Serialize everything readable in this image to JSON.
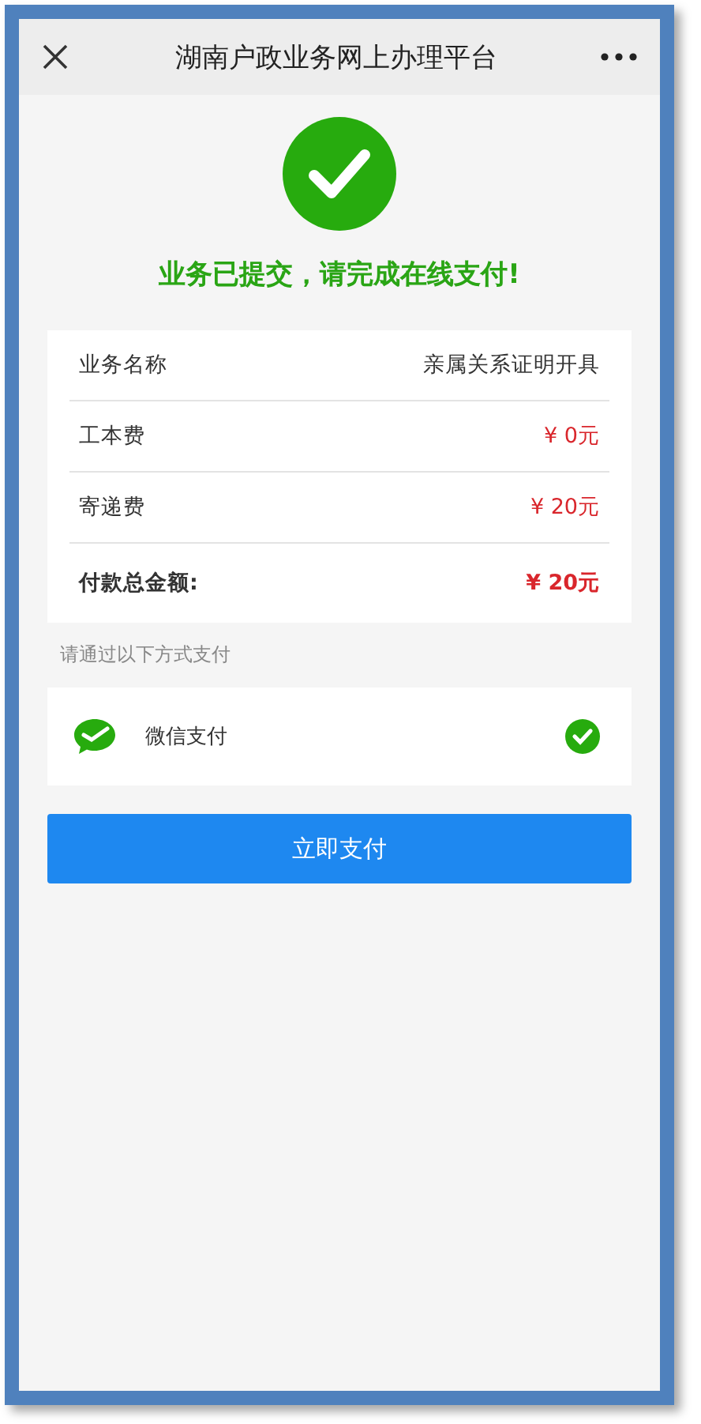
{
  "header": {
    "title": "湖南户政业务网上办理平台"
  },
  "status": {
    "message": "业务已提交，请完成在线支付!"
  },
  "details": [
    {
      "kind": "text",
      "label": "业务名称",
      "value": "亲属关系证明开具"
    },
    {
      "kind": "fee",
      "label": "工本费",
      "value": "¥ 0元"
    },
    {
      "kind": "fee",
      "label": "寄递费",
      "value": "¥ 20元"
    },
    {
      "kind": "total",
      "label": "付款总金额:",
      "value": "¥ 20元"
    }
  ],
  "payment_hint": "请通过以下方式支付",
  "payment_methods": [
    {
      "label": "微信支付",
      "selected": true
    }
  ],
  "pay_button": "立即支付"
}
